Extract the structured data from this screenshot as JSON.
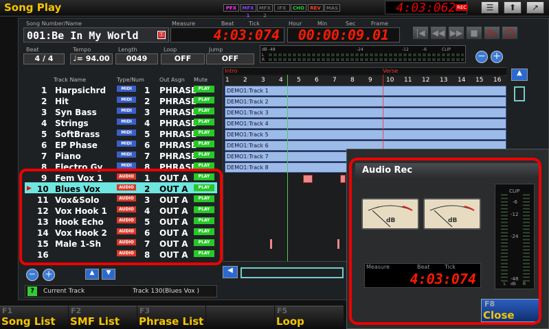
{
  "app": {
    "title": "Song Play",
    "clock": "4:03:062",
    "rec_badge": "REC",
    "fx": [
      {
        "label": "PFX",
        "color": "#ff33ff"
      },
      {
        "label": "MFX 1",
        "color": "#8844ff"
      },
      {
        "label": "MFX 2",
        "color": "#666666"
      },
      {
        "label": "IFX",
        "color": "#666666"
      },
      {
        "label": "CHO",
        "color": "#33cc33"
      },
      {
        "label": "REV",
        "color": "#ff4422"
      },
      {
        "label": "MAS",
        "color": "#666666"
      }
    ],
    "buttons": [
      {
        "icon": "list-icon",
        "glyph": "☰"
      },
      {
        "icon": "up-arrow-icon",
        "glyph": "⬆"
      },
      {
        "icon": "exit-icon",
        "glyph": "↗"
      }
    ]
  },
  "song": {
    "name_label": "Song Number/Name",
    "name": "001:Be In My World",
    "measure_label": "Measure",
    "beat_label": "Beat",
    "tick_label": "Tick",
    "position": "4:03:074",
    "hour_label": "Hour",
    "min_label": "Min",
    "sec_label": "Sec",
    "frame_label": "Frame",
    "time": "00:00:09.01",
    "beat_title": "Beat",
    "beat": "4 / 4",
    "tempo_title": "Tempo",
    "tempo": "♩= 94.00",
    "length_title": "Length",
    "length": "0049",
    "loop_title": "Loop",
    "loop": "OFF",
    "jump_title": "Jump",
    "jump": "OFF",
    "meter_scale": [
      "dB -48",
      "-24",
      "-12",
      "-6",
      "CLIP"
    ],
    "meter_lr": [
      "L",
      "R"
    ]
  },
  "transport": [
    "|◀",
    "◀◀",
    "▶▶",
    "■",
    "▷",
    "○"
  ],
  "headers": {
    "track_name": "Track Name",
    "type_num": "Type/Num",
    "out_assign": "Out Asgn",
    "mute": "Mute"
  },
  "tracks": [
    {
      "num": "1",
      "name": "Harpsichrd",
      "type": "MIDI",
      "n": "1",
      "out": "PHRASE",
      "mute": "PLAY"
    },
    {
      "num": "2",
      "name": "Hit",
      "type": "MIDI",
      "n": "2",
      "out": "PHRASE",
      "mute": "PLAY"
    },
    {
      "num": "3",
      "name": "Syn Bass",
      "type": "MIDI",
      "n": "3",
      "out": "PHRASE",
      "mute": "PLAY"
    },
    {
      "num": "4",
      "name": "Strings",
      "type": "MIDI",
      "n": "4",
      "out": "PHRASE",
      "mute": "PLAY"
    },
    {
      "num": "5",
      "name": "SoftBrass",
      "type": "MIDI",
      "n": "5",
      "out": "PHRASE",
      "mute": "PLAY"
    },
    {
      "num": "6",
      "name": "EP Phase",
      "type": "MIDI",
      "n": "6",
      "out": "PHRASE",
      "mute": "PLAY"
    },
    {
      "num": "7",
      "name": "Piano",
      "type": "MIDI",
      "n": "7",
      "out": "PHRASE",
      "mute": "PLAY"
    },
    {
      "num": "8",
      "name": "Electro Gy",
      "type": "MIDI",
      "n": "8",
      "out": "PHRASE",
      "mute": "PLAY"
    },
    {
      "num": "9",
      "name": "Fem Vox 1",
      "type": "AUDIO",
      "n": "1",
      "out": "OUT A",
      "mute": "PLAY"
    },
    {
      "num": "10",
      "name": "Blues Vox",
      "type": "AUDIO",
      "n": "2",
      "out": "OUT A",
      "mute": "PLAY"
    },
    {
      "num": "11",
      "name": "Vox&Solo",
      "type": "AUDIO",
      "n": "3",
      "out": "OUT A",
      "mute": "PLAY"
    },
    {
      "num": "12",
      "name": "Vox Hook 1",
      "type": "AUDIO",
      "n": "4",
      "out": "OUT A",
      "mute": "PLAY"
    },
    {
      "num": "13",
      "name": "Hook Echo",
      "type": "AUDIO",
      "n": "5",
      "out": "OUT A",
      "mute": "PLAY"
    },
    {
      "num": "14",
      "name": "Vox Hook 2",
      "type": "AUDIO",
      "n": "6",
      "out": "OUT A",
      "mute": "PLAY"
    },
    {
      "num": "15",
      "name": "Male 1-Sh",
      "type": "AUDIO",
      "n": "7",
      "out": "OUT A",
      "mute": "PLAY"
    },
    {
      "num": "16",
      "name": "",
      "type": "AUDIO",
      "n": "8",
      "out": "OUT A",
      "mute": "PLAY"
    }
  ],
  "markers": {
    "intro": "Intro",
    "verse": "Verse"
  },
  "measures": [
    "1",
    "2",
    "3",
    "4",
    "5",
    "6",
    "7",
    "8",
    "9",
    "10",
    "11",
    "12",
    "13",
    "14",
    "15",
    "16"
  ],
  "blocks": [
    "DEMO1:Track 1",
    "DEMO1:Track 2",
    "DEMO1:Track 3",
    "DEMO1:Track 4",
    "DEMO1:Track 5",
    "DEMO1:Track 6",
    "DEMO1:Track 7",
    "DEMO1:Track 8"
  ],
  "status": {
    "help": "?",
    "label": "Current Track",
    "value": "Track 130(Blues Vox )"
  },
  "audio_rec": {
    "title": "Audio Rec",
    "meter_unit": "dB",
    "measure_label": "Measure",
    "beat_label": "Beat",
    "tick_label": "Tick",
    "position": "4:03:074",
    "clip": "CLIP",
    "scale": [
      "-6",
      "-12",
      "-24",
      "-48",
      "dB"
    ],
    "lr": [
      "L",
      "R"
    ],
    "close_key": "F8",
    "close_label": "Close"
  },
  "fkeys": [
    {
      "key": "F1",
      "label": "Song List"
    },
    {
      "key": "F2",
      "label": "SMF List"
    },
    {
      "key": "F3",
      "label": "Phrase List"
    },
    {
      "key": "F5",
      "label": "Loop"
    }
  ]
}
